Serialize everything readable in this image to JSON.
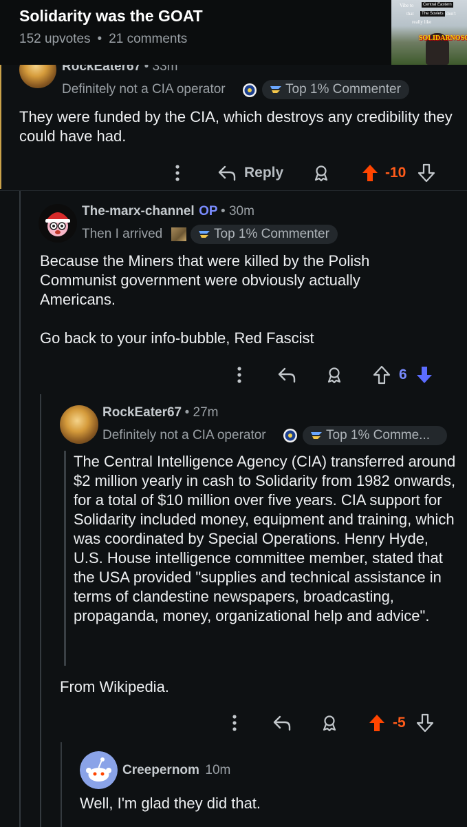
{
  "post": {
    "title": "Solidarity was the GOAT",
    "upvotes": "152 upvotes",
    "separator": "•",
    "comments": "21 comments",
    "thumbnail": {
      "line1": "Vibe to",
      "box1": "Central Eastern",
      "line2": "that",
      "box2": "The Soviets",
      "line3": "don't",
      "line4": "really like",
      "red": "SOLIDARNOSC"
    }
  },
  "comments": [
    {
      "author": "RockEater67",
      "time": "• 33m",
      "flair": "Definitely not a CIA operator",
      "badge": "Top 1% Commenter",
      "body": "They were funded by the CIA, which destroys any credibility they could have had.",
      "reply_label": "Reply",
      "score": "-10",
      "vote_state": "upvoted"
    },
    {
      "author": "The-marx-channel",
      "op_tag": "OP",
      "time": "• 30m",
      "flair": "Then I arrived",
      "badge": "Top 1% Commenter",
      "body_p1": "Because the Miners that were killed by the Polish Communist government were obviously actually Americans.",
      "body_p2": "Go back to your info-bubble, Red Fascist",
      "score": "6",
      "vote_state": "downvoted"
    },
    {
      "author": "RockEater67",
      "time": "• 27m",
      "flair": "Definitely not a CIA operator",
      "badge": "Top 1% Comme...",
      "quote": "The Central Intelligence Agency (CIA) transferred around $2 million yearly in cash to Solidarity from 1982 onwards, for a total of $10 million over five years. CIA support for Solidarity included money, equipment and training, which was coordinated by Special Operations. Henry Hyde, U.S. House intelligence committee member, stated that the USA provided \"supplies and technical assistance in terms of clandestine newspapers, broadcasting, propaganda, money, organizational help and advice\".",
      "body": "From Wikipedia.",
      "score": "-5",
      "vote_state": "upvoted"
    },
    {
      "author": "Creepernom",
      "time": "10m",
      "body": "Well, I'm glad they did that."
    }
  ],
  "icons": {
    "more": "more-vertical-icon",
    "reply": "reply-arrow-icon",
    "award": "award-icon",
    "upvote": "upvote-arrow-icon",
    "downvote": "downvote-arrow-icon",
    "cia_seal": "cia-seal-icon",
    "top_commenter": "top-commenter-icon"
  },
  "colors": {
    "background": "#0e1113",
    "upvote_active": "#ff4500",
    "downvote_active": "#5b6cff",
    "op_tag": "#7a8cff"
  }
}
